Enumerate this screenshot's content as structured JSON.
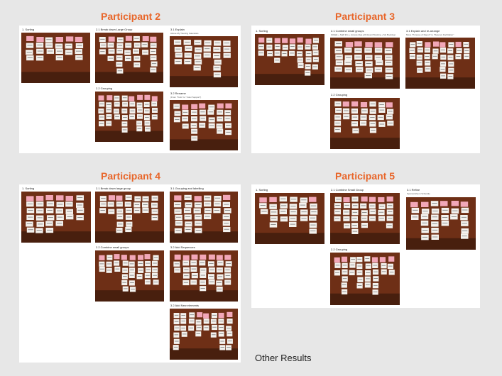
{
  "participants": [
    {
      "title": "Participant 2",
      "sections": [
        {
          "label": "1. Sorting",
          "sub": ""
        },
        {
          "label": "2.1 Break down Large Group",
          "sub": ""
        },
        {
          "label": "2.2 Grouping",
          "sub": ""
        },
        {
          "label": "3.1 Explain",
          "sub": "Above My Tutoring Calendars"
        },
        {
          "label": "3.2 Rename",
          "sub": "(From \"Todo\" to \"Color Support\")"
        }
      ]
    },
    {
      "title": "Participant 3",
      "sections": [
        {
          "label": "1. Sorting",
          "sub": ""
        },
        {
          "label": "2.1 Combine small groups",
          "sub": "(SGEE + Staff Info + Access Idea with Event Booking + My Booking)"
        },
        {
          "label": "2.2 Grouping",
          "sub": ""
        },
        {
          "label": "3.1 Explain and re-arrange",
          "sub": "Move \"Purpose of Report\" to \"Reserve Facilitation\""
        }
      ]
    },
    {
      "title": "Participant 4",
      "sections": [
        {
          "label": "1. Sorting",
          "sub": ""
        },
        {
          "label": "2.1 Break down large group",
          "sub": ""
        },
        {
          "label": "2.2 Combine small groups",
          "sub": ""
        },
        {
          "label": "3.1 Grouping and labelling",
          "sub": ""
        },
        {
          "label": "3.2 Add Sequences",
          "sub": ""
        },
        {
          "label": "3.2 Add New elements",
          "sub": ""
        }
      ]
    },
    {
      "title": "Participant 5",
      "sections": [
        {
          "label": "1. Sorting",
          "sub": ""
        },
        {
          "label": "2.1 Combine Small Group",
          "sub": ""
        },
        {
          "label": "2.2 Grouping",
          "sub": ""
        },
        {
          "label": "3.1 Refine",
          "sub": "Sponsorship & Schedule"
        }
      ]
    }
  ],
  "footer": {
    "other_results": "Other Results"
  },
  "colors": {
    "title": "#e8662a",
    "table": "#6e2f16",
    "card": "#f4f2ee",
    "sticky": "#f2a7b8",
    "background": "#e7e7e7"
  }
}
